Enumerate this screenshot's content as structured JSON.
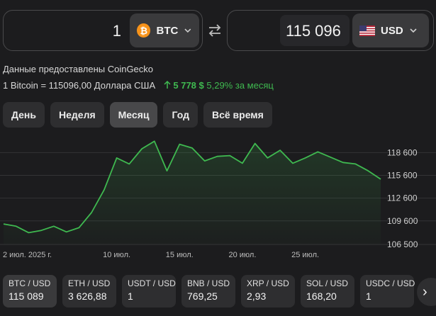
{
  "converter": {
    "from_amount": "1",
    "from_currency": "BTC",
    "from_icon": "bitcoin-icon",
    "to_amount": "115 096",
    "to_currency": "USD",
    "to_icon": "us-flag-icon",
    "swap_icon": "swap-arrows-icon"
  },
  "info": {
    "source": "Данные предоставлены CoinGecko",
    "rate": "1 Bitcoin = 115096,00 Доллара США",
    "change_abs": "5 778 $",
    "change_pct": "5,29%",
    "change_period": "за месяц",
    "change_color": "#3fb950"
  },
  "tabs": [
    {
      "label": "День"
    },
    {
      "label": "Неделя"
    },
    {
      "label": "Месяц",
      "active": true
    },
    {
      "label": "Год"
    },
    {
      "label": "Всё время"
    }
  ],
  "chart_data": {
    "type": "area",
    "x": [
      "2025-07-01",
      "2025-07-02",
      "2025-07-03",
      "2025-07-04",
      "2025-07-05",
      "2025-07-06",
      "2025-07-07",
      "2025-07-08",
      "2025-07-09",
      "2025-07-10",
      "2025-07-11",
      "2025-07-12",
      "2025-07-13",
      "2025-07-14",
      "2025-07-15",
      "2025-07-16",
      "2025-07-17",
      "2025-07-18",
      "2025-07-19",
      "2025-07-20",
      "2025-07-21",
      "2025-07-22",
      "2025-07-23",
      "2025-07-24",
      "2025-07-25",
      "2025-07-26",
      "2025-07-27",
      "2025-07-28",
      "2025-07-29",
      "2025-07-30",
      "2025-07-31"
    ],
    "values": [
      109200,
      108900,
      108050,
      108350,
      108900,
      108150,
      108700,
      110700,
      113700,
      117900,
      117100,
      119100,
      120100,
      116200,
      119700,
      119200,
      117500,
      118100,
      118200,
      117200,
      119800,
      117900,
      118900,
      117200,
      117900,
      118700,
      118000,
      117300,
      117100,
      116200,
      115100
    ],
    "xtick_labels": [
      {
        "x": "2025-07-02",
        "label": "2 июл. 2025 г."
      },
      {
        "x": "2025-07-10",
        "label": "10 июл."
      },
      {
        "x": "2025-07-15",
        "label": "15 июл."
      },
      {
        "x": "2025-07-20",
        "label": "20 июл."
      },
      {
        "x": "2025-07-25",
        "label": "25 июл."
      }
    ],
    "yticks": [
      106500,
      109600,
      112600,
      115600,
      118600
    ],
    "ytick_labels": [
      "106 500",
      "109 600",
      "112 600",
      "115 600",
      "118 600"
    ],
    "ylim": [
      106500,
      120500
    ],
    "grid": true,
    "line_color": "#3fb950",
    "axis_position": "right"
  },
  "pairs": [
    {
      "name": "BTC / USD",
      "value": "115 089"
    },
    {
      "name": "ETH / USD",
      "value": "3 626,88"
    },
    {
      "name": "USDT / USD",
      "value": "1"
    },
    {
      "name": "BNB / USD",
      "value": "769,25"
    },
    {
      "name": "XRP / USD",
      "value": "2,93"
    },
    {
      "name": "SOL / USD",
      "value": "168,20"
    },
    {
      "name": "USDC / USD",
      "value": "1"
    }
  ],
  "next_icon": "chevron-right-icon"
}
